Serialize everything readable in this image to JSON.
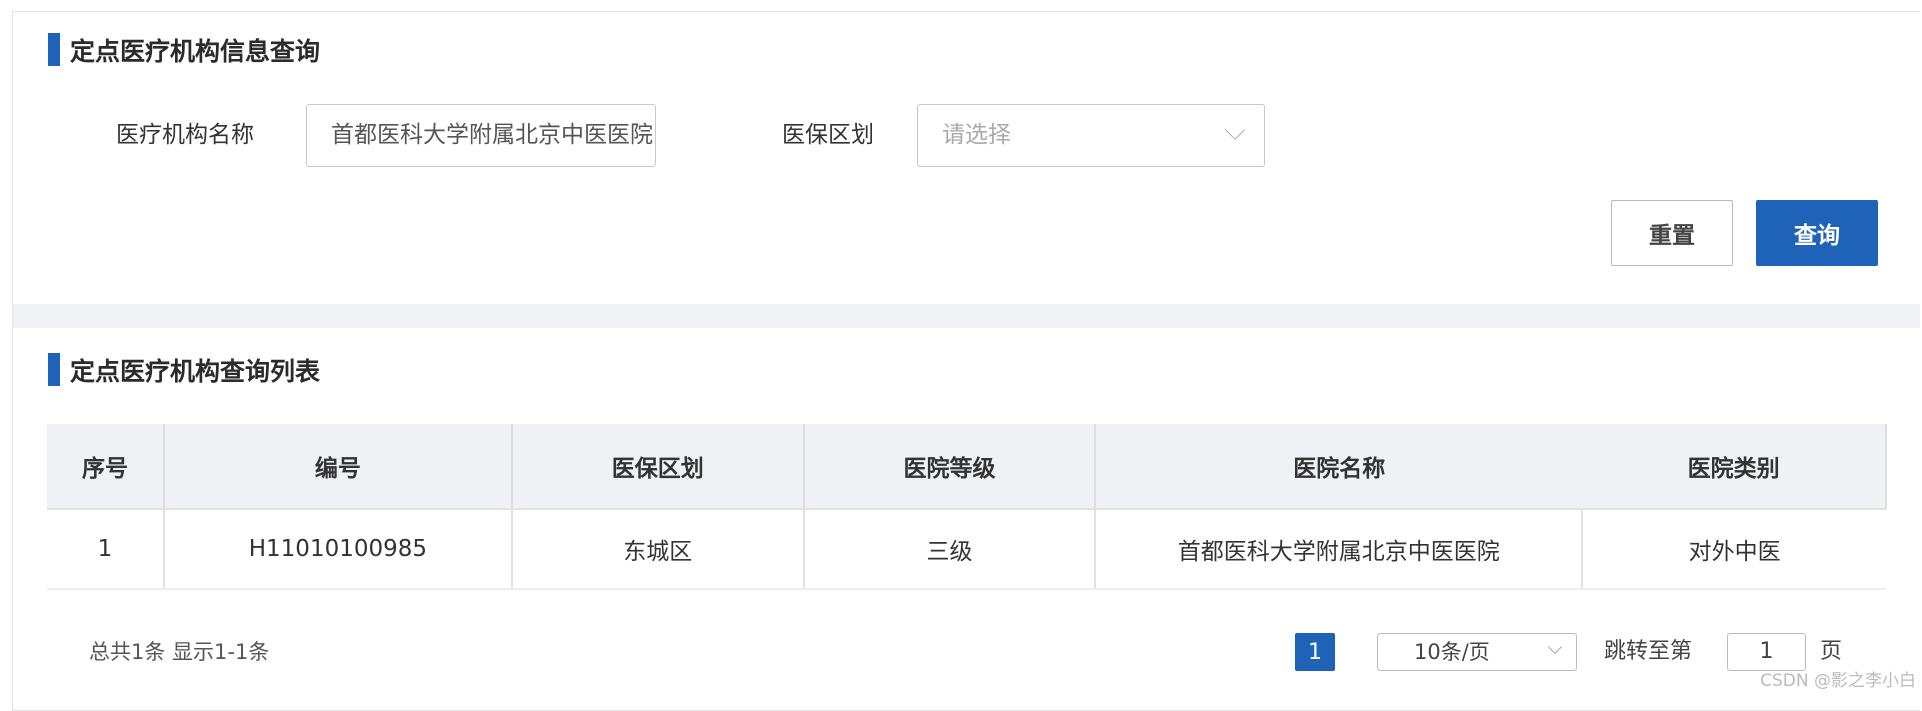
{
  "search": {
    "title": "定点医疗机构信息查询",
    "name_label": "医疗机构名称",
    "name_value": "首都医科大学附属北京中医医院",
    "region_label": "医保区划",
    "region_placeholder": "请选择",
    "reset": "重置",
    "query": "查询"
  },
  "list": {
    "title": "定点医疗机构查询列表",
    "columns": [
      "序号",
      "编号",
      "医保区划",
      "医院等级",
      "医院名称",
      "医院类别"
    ],
    "rows": [
      [
        "1",
        "H11010100985",
        "东城区",
        "三级",
        "首都医科大学附属北京中医医院",
        "对外中医"
      ]
    ]
  },
  "pagination": {
    "summary": "总共1条 显示1-1条",
    "current_page": "1",
    "page_size": "10条/页",
    "jump_label": "跳转至第",
    "jump_value": "1",
    "page_suffix": "页"
  },
  "watermark": "CSDN @影之李小白",
  "colors": {
    "accent": "#1f63b8",
    "header_bg": "#eff1f5"
  }
}
